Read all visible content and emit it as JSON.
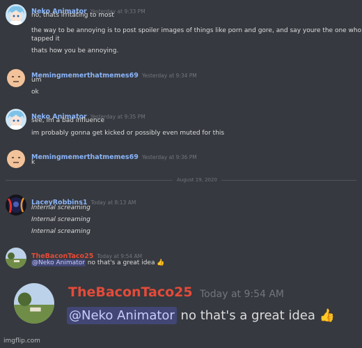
{
  "messages": [
    {
      "author": "Neko Animator",
      "author_color": "#8ab4f8",
      "timestamp": "Yesterday at 9:33 PM",
      "lines": [
        "no, thats irritating to most",
        "the way to be annoying is to post spoiler images of things like porn and gore, and say youre the one who",
        "tapped it",
        "thats how you be annoying."
      ]
    },
    {
      "author": "Memingmemerthatmemes69",
      "author_color": "#8ab4f8",
      "timestamp": "Yesterday at 9:34 PM",
      "lines": [
        "um",
        "ok"
      ]
    },
    {
      "author": "Neko Animator",
      "author_color": "#8ab4f8",
      "timestamp": "Yesterday at 9:35 PM",
      "lines": [
        "see, im a bad influence",
        "im probably gonna get kicked or possibly even muted for this"
      ]
    },
    {
      "author": "Memingmemerthatmemes69",
      "author_color": "#8ab4f8",
      "timestamp": "Yesterday at 9:36 PM",
      "lines": [
        "k"
      ]
    },
    {
      "author": "LaceyRobbins1",
      "author_color": "#8ab4f8",
      "timestamp": "Today at 8:13 AM",
      "lines": [
        "Internal screaming",
        "Internal screaming",
        "Internal screaming"
      ]
    },
    {
      "author": "TheBaconTaco25",
      "author_color": "#e44b39",
      "timestamp": "Today at 9:54 AM",
      "mention": "@Neko Animator",
      "text": " no that's a great idea",
      "emoji": "👍"
    }
  ],
  "divider_date": "August 19, 2020",
  "zoom": {
    "author": "TheBaconTaco25",
    "timestamp": "Today at 9:54 AM",
    "mention": "@Neko Animator",
    "text": " no that's a great idea",
    "emoji": "👍"
  },
  "watermark": "imgflip.com",
  "icons": {
    "neko_avatar": "anime-character-avatar",
    "meming_avatar": "blank-face-avatar",
    "lacey_avatar": "dark-avatar",
    "bacon_avatar": "landscape-avatar",
    "thumbs_up": "thumbs-up-emoji"
  }
}
